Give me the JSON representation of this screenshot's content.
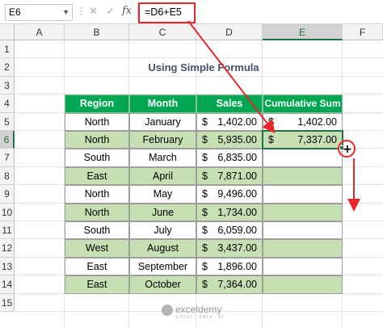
{
  "formula_bar": {
    "name_box": "E6",
    "formula": "=D6+E5",
    "fx_label": "fx"
  },
  "columns": [
    "A",
    "B",
    "C",
    "D",
    "E",
    "F"
  ],
  "rows": [
    "1",
    "2",
    "3",
    "4",
    "5",
    "6",
    "7",
    "8",
    "9",
    "10",
    "11",
    "12",
    "13",
    "14",
    "15"
  ],
  "title": "Using Simple Formula",
  "table": {
    "headers": [
      "Region",
      "Month",
      "Sales",
      "Cumulative Sum"
    ],
    "currency_symbol": "$",
    "rows": [
      {
        "region": "North",
        "month": "January",
        "sales": "1,402.00",
        "cumsum": "1,402.00"
      },
      {
        "region": "North",
        "month": "February",
        "sales": "5,935.00",
        "cumsum": "7,337.00"
      },
      {
        "region": "South",
        "month": "March",
        "sales": "6,835.00",
        "cumsum": ""
      },
      {
        "region": "East",
        "month": "April",
        "sales": "7,871.00",
        "cumsum": ""
      },
      {
        "region": "North",
        "month": "May",
        "sales": "9,496.00",
        "cumsum": ""
      },
      {
        "region": "North",
        "month": "June",
        "sales": "1,734.00",
        "cumsum": ""
      },
      {
        "region": "South",
        "month": "July",
        "sales": "6,059.00",
        "cumsum": ""
      },
      {
        "region": "West",
        "month": "August",
        "sales": "3,437.00",
        "cumsum": ""
      },
      {
        "region": "East",
        "month": "September",
        "sales": "1,896.00",
        "cumsum": ""
      },
      {
        "region": "East",
        "month": "October",
        "sales": "7,364.00",
        "cumsum": ""
      }
    ]
  },
  "watermark": {
    "brand": "exceldemy",
    "tagline": "EXCEL · DATA · BI"
  },
  "colors": {
    "header_green": "#00a651",
    "row_shade": "#c6e0b4",
    "annotation_red": "#e8262b",
    "title_color": "#44546a"
  }
}
